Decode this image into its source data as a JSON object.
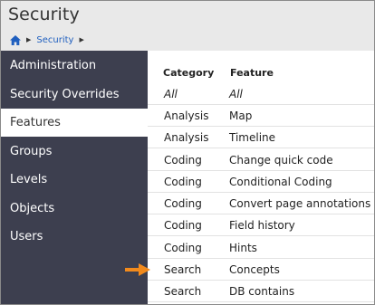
{
  "header": {
    "title": "Security",
    "breadcrumb": {
      "current": "Security"
    }
  },
  "sidebar": {
    "items": [
      {
        "label": "Administration"
      },
      {
        "label": "Security Overrides"
      },
      {
        "label": "Features",
        "active": true
      },
      {
        "label": "Groups"
      },
      {
        "label": "Levels"
      },
      {
        "label": "Objects"
      },
      {
        "label": "Users"
      }
    ]
  },
  "table": {
    "headers": {
      "category": "Category",
      "feature": "Feature"
    },
    "rows": [
      {
        "category": "All",
        "feature": "All"
      },
      {
        "category": "Analysis",
        "feature": "Map"
      },
      {
        "category": "Analysis",
        "feature": "Timeline"
      },
      {
        "category": "Coding",
        "feature": "Change quick code"
      },
      {
        "category": "Coding",
        "feature": "Conditional Coding"
      },
      {
        "category": "Coding",
        "feature": "Convert page annotations"
      },
      {
        "category": "Coding",
        "feature": "Field history"
      },
      {
        "category": "Coding",
        "feature": "Hints"
      },
      {
        "category": "Search",
        "feature": "Concepts"
      },
      {
        "category": "Search",
        "feature": "DB contains"
      }
    ]
  },
  "colors": {
    "sidebar_bg": "#3d3f4f",
    "header_bg": "#e9e9e9",
    "link": "#1f5fbf",
    "arrow": "#f28a1c"
  },
  "icons": {
    "home": "home-icon",
    "separator": "chevron-right-icon",
    "pointer": "arrow-right-icon"
  }
}
